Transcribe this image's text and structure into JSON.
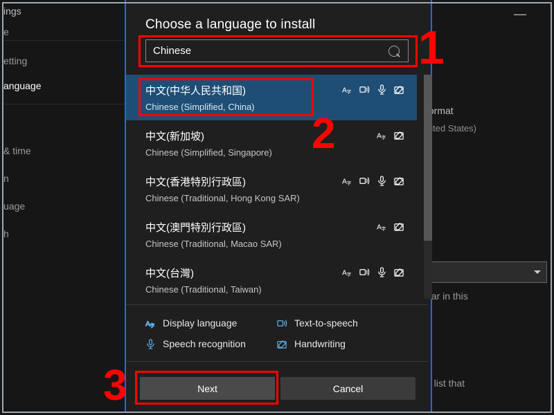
{
  "background": {
    "header_fragment": "ings",
    "nav": {
      "line1": "e",
      "setting": "etting",
      "time": "& time",
      "n": "n",
      "uage": "uage",
      "h": "h"
    },
    "active_nav": "anguage",
    "right_format": "format",
    "right_states": "nited States)",
    "right_ear": "ear in this",
    "right_list": "e list that"
  },
  "dialog": {
    "title": "Choose a language to install",
    "search_value": "Chinese",
    "languages": [
      {
        "native": "中文(中华人民共和国)",
        "english": "Chinese (Simplified, China)",
        "features": [
          "display",
          "tts",
          "speech",
          "hand"
        ],
        "selected": true
      },
      {
        "native": "中文(新加坡)",
        "english": "Chinese (Simplified, Singapore)",
        "features": [
          "display",
          "hand"
        ],
        "selected": false
      },
      {
        "native": "中文(香港特別行政區)",
        "english": "Chinese (Traditional, Hong Kong SAR)",
        "features": [
          "display",
          "tts",
          "speech",
          "hand"
        ],
        "selected": false
      },
      {
        "native": "中文(澳門特別行政區)",
        "english": "Chinese (Traditional, Macao SAR)",
        "features": [
          "display",
          "hand"
        ],
        "selected": false
      },
      {
        "native": "中文(台灣)",
        "english": "Chinese (Traditional, Taiwan)",
        "features": [
          "display",
          "tts",
          "speech",
          "hand"
        ],
        "selected": false
      }
    ],
    "legend": {
      "display": "Display language",
      "tts": "Text-to-speech",
      "speech": "Speech recognition",
      "hand": "Handwriting"
    },
    "next": "Next",
    "cancel": "Cancel"
  },
  "annotations": {
    "n1": "1",
    "n2": "2",
    "n3": "3"
  }
}
